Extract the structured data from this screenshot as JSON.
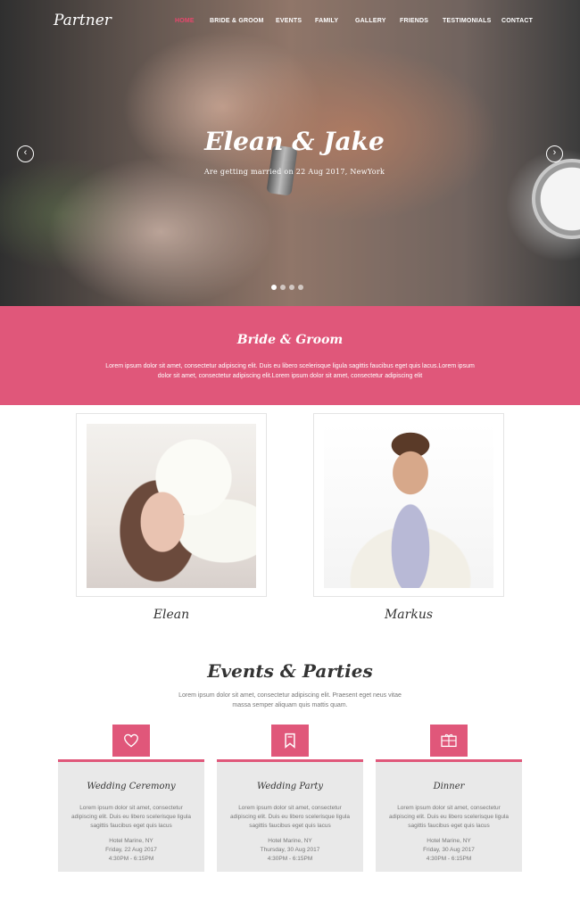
{
  "brand": {
    "logo": "Partner"
  },
  "nav": {
    "items": [
      {
        "label": "HOME",
        "active": true
      },
      {
        "label": "BRIDE & GROOM",
        "active": false
      },
      {
        "label": "EVENTS",
        "active": false
      },
      {
        "label": "FAMILY",
        "active": false
      },
      {
        "label": "GALLERY",
        "active": false
      },
      {
        "label": "FRIENDS",
        "active": false
      },
      {
        "label": "TESTIMONIALS",
        "active": false
      },
      {
        "label": "CONTACT",
        "active": false
      }
    ]
  },
  "hero": {
    "title": "Elean & Jake",
    "subtitle": "Are getting married on 22 Aug 2017, NewYork",
    "prev_icon": "chevron-left-icon",
    "next_icon": "chevron-right-icon",
    "slide_count": 4,
    "active_slide": 1
  },
  "bride_groom": {
    "title": "Bride & Groom",
    "text": "Lorem ipsum dolor sit amet, consectetur adipiscing elit. Duis eu libero scelerisque ligula sagittis faucibus eget quis lacus.Lorem ipsum dolor sit amet, consectetur adipiscing elit.Lorem ipsum dolor sit amet, consectetur adipiscing elit",
    "bride_name": "Elean",
    "groom_name": "Markus"
  },
  "events": {
    "title": "Events & Parties",
    "text": "Lorem ipsum dolor sit amet, consectetur adipiscing elit. Praesent eget neus vitae massa semper aliquam quis mattis quam.",
    "cards": [
      {
        "icon": "heart-icon",
        "title": "Wedding Ceremony",
        "text": "Lorem ipsum dolor sit amet, consectetur adipiscing elit. Duis eu libero scelerisque ligula sagittis faucibus eget quis lacus",
        "place": "Hotel Marine, NY",
        "date": "Friday, 22 Aug 2017",
        "time": "4:30PM - 6:15PM"
      },
      {
        "icon": "bookmark-icon",
        "title": "Wedding Party",
        "text": "Lorem ipsum dolor sit amet, consectetur adipiscing elit. Duis eu libero scelerisque ligula sagittis faucibus eget quis lacus",
        "place": "Hotel Marine, NY",
        "date": "Thursday, 30 Aug 2017",
        "time": "4:30PM - 6:15PM"
      },
      {
        "icon": "gift-icon",
        "title": "Dinner",
        "text": "Lorem ipsum dolor sit amet, consectetur adipiscing elit. Duis eu libero scelerisque ligula sagittis faucibus eget quis lacus",
        "place": "Hotel Marine, NY",
        "date": "Friday, 30 Aug 2017",
        "time": "4:30PM - 6:15PM"
      }
    ]
  },
  "colors": {
    "accent": "#e0577a",
    "active_nav": "#e8476c",
    "card_bg": "#e9e9e9"
  }
}
